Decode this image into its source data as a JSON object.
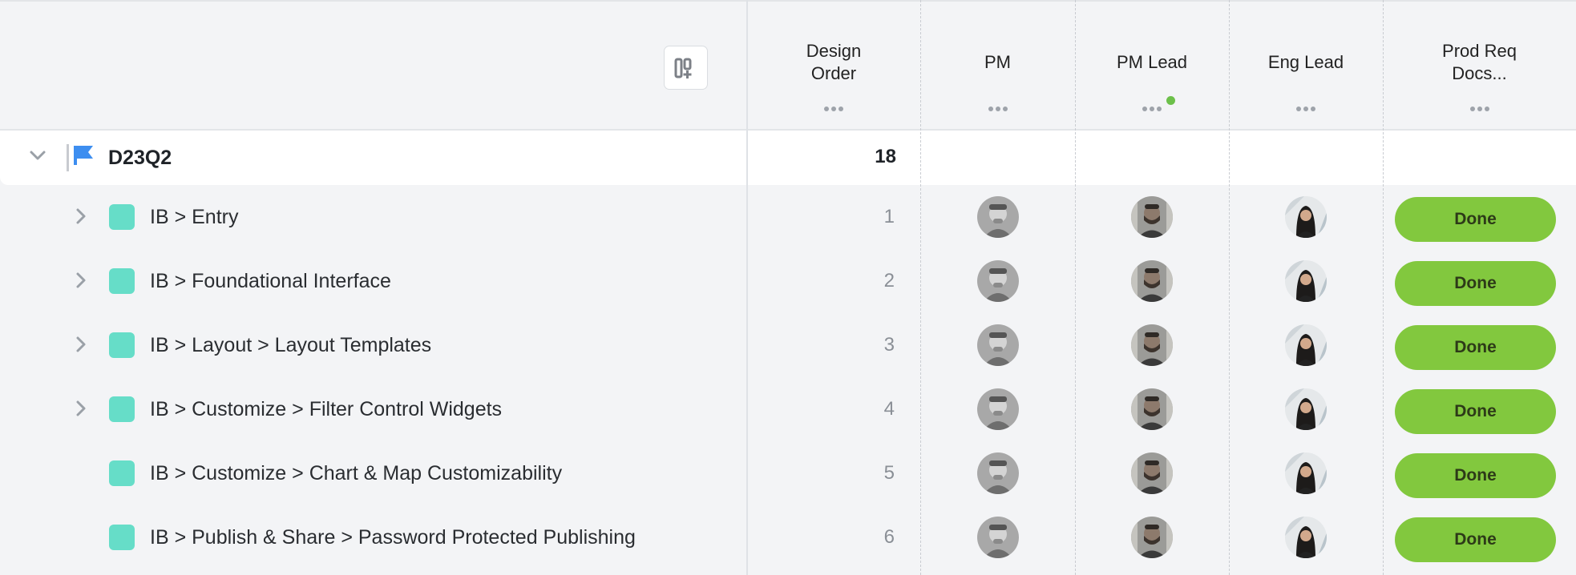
{
  "header": {
    "columns": {
      "design_order": "Design\nOrder",
      "pm": "PM",
      "pm_lead": "PM Lead",
      "eng_lead": "Eng Lead",
      "prod_req": "Prod Req\nDocs..."
    },
    "add_column_icon": "add-column-icon",
    "pm_lead_status_color": "#6cc04a"
  },
  "group": {
    "name": "D23Q2",
    "count": "18",
    "flag_color": "#3d8ef0"
  },
  "rows": [
    {
      "name": "IB > Entry",
      "order": "1",
      "status": "Done",
      "expandable": true
    },
    {
      "name": "IB > Foundational Interface",
      "order": "2",
      "status": "Done",
      "expandable": true
    },
    {
      "name": "IB > Layout > Layout Templates",
      "order": "3",
      "status": "Done",
      "expandable": true
    },
    {
      "name": "IB > Customize > Filter Control Widgets",
      "order": "4",
      "status": "Done",
      "expandable": true
    },
    {
      "name": "IB > Customize > Chart & Map Customizability",
      "order": "5",
      "status": "Done",
      "expandable": false
    },
    {
      "name": "IB > Publish & Share > Password Protected Publishing",
      "order": "6",
      "status": "Done",
      "expandable": false
    }
  ],
  "colors": {
    "swatch": "#66ddc8",
    "done": "#82c83e"
  }
}
